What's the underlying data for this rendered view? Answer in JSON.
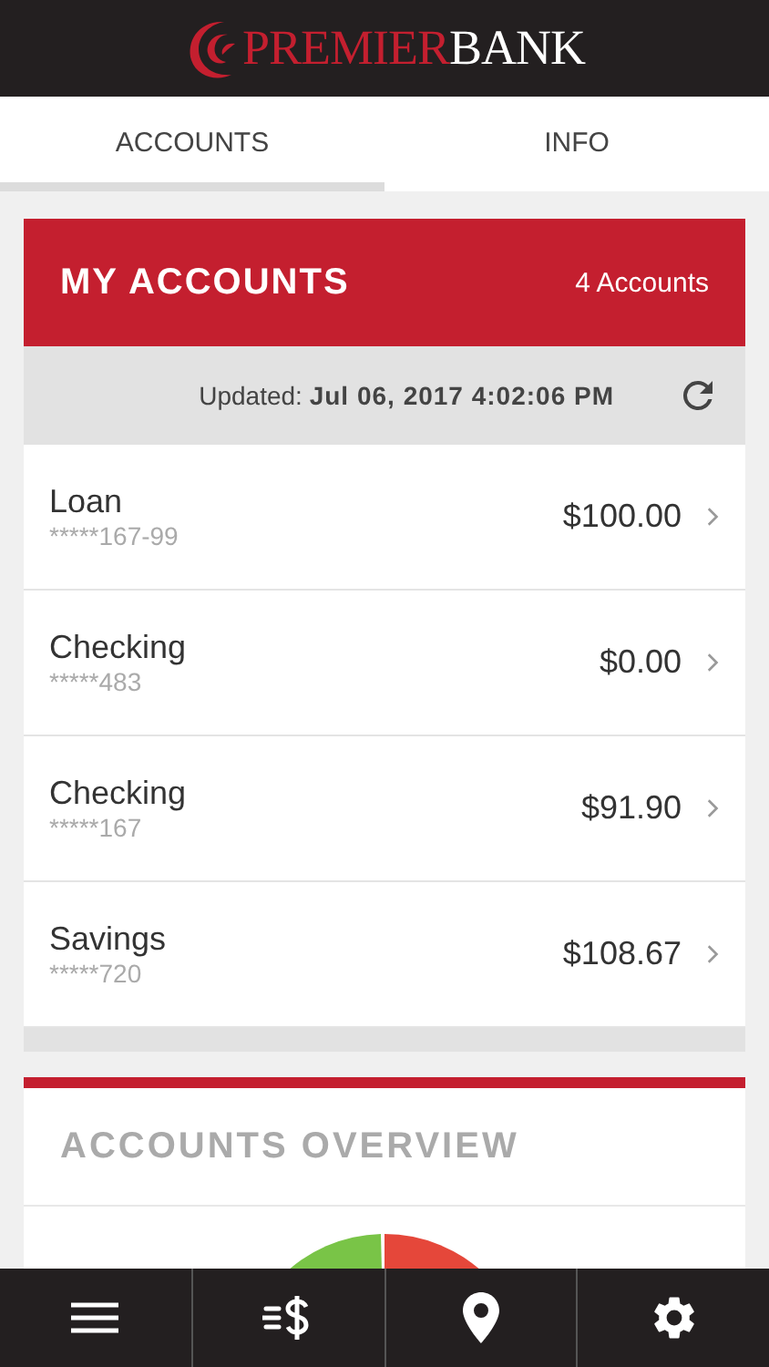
{
  "logo": {
    "first": "PREMIER",
    "second": "BANK"
  },
  "tabs": [
    {
      "label": "ACCOUNTS",
      "selected": true
    },
    {
      "label": "INFO",
      "selected": false
    }
  ],
  "accounts_card": {
    "title": "MY ACCOUNTS",
    "count": "4 Accounts",
    "updated": "Updated: **Jul 06, 2017 4:02:06 PM**",
    "rows": [
      {
        "name": "Loan",
        "number": "*****167-99",
        "amount": "$100.00"
      },
      {
        "name": "Checking",
        "number": "*****483",
        "amount": "$0.00"
      },
      {
        "name": "Checking",
        "number": "*****167",
        "amount": "$91.90"
      },
      {
        "name": "Savings",
        "number": "*****720",
        "amount": "$108.67"
      }
    ]
  },
  "overview": {
    "title": "ACCOUNTS OVERVIEW"
  },
  "bottom_nav": [
    {
      "kind": "menu"
    },
    {
      "kind": "transfer"
    },
    {
      "kind": "location"
    },
    {
      "kind": "settings"
    }
  ]
}
